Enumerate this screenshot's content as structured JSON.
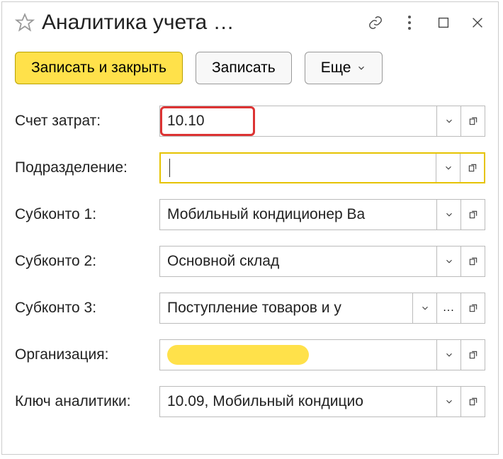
{
  "window": {
    "title": "Аналитика учета …"
  },
  "toolbar": {
    "save_close": "Записать и закрыть",
    "save": "Записать",
    "more": "Еще"
  },
  "labels": {
    "account": "Счет затрат:",
    "department": "Подразделение:",
    "sub1": "Субконто 1:",
    "sub2": "Субконто 2:",
    "sub3": "Субконто 3:",
    "org": "Организация:",
    "key": "Ключ аналитики:"
  },
  "values": {
    "account": "10.10",
    "department": "",
    "sub1": "Мобильный кондиционер Ва",
    "sub2": "Основной склад",
    "sub3": "Поступление товаров и у",
    "org": "",
    "key": "10.09, Мобильный кондицио"
  }
}
